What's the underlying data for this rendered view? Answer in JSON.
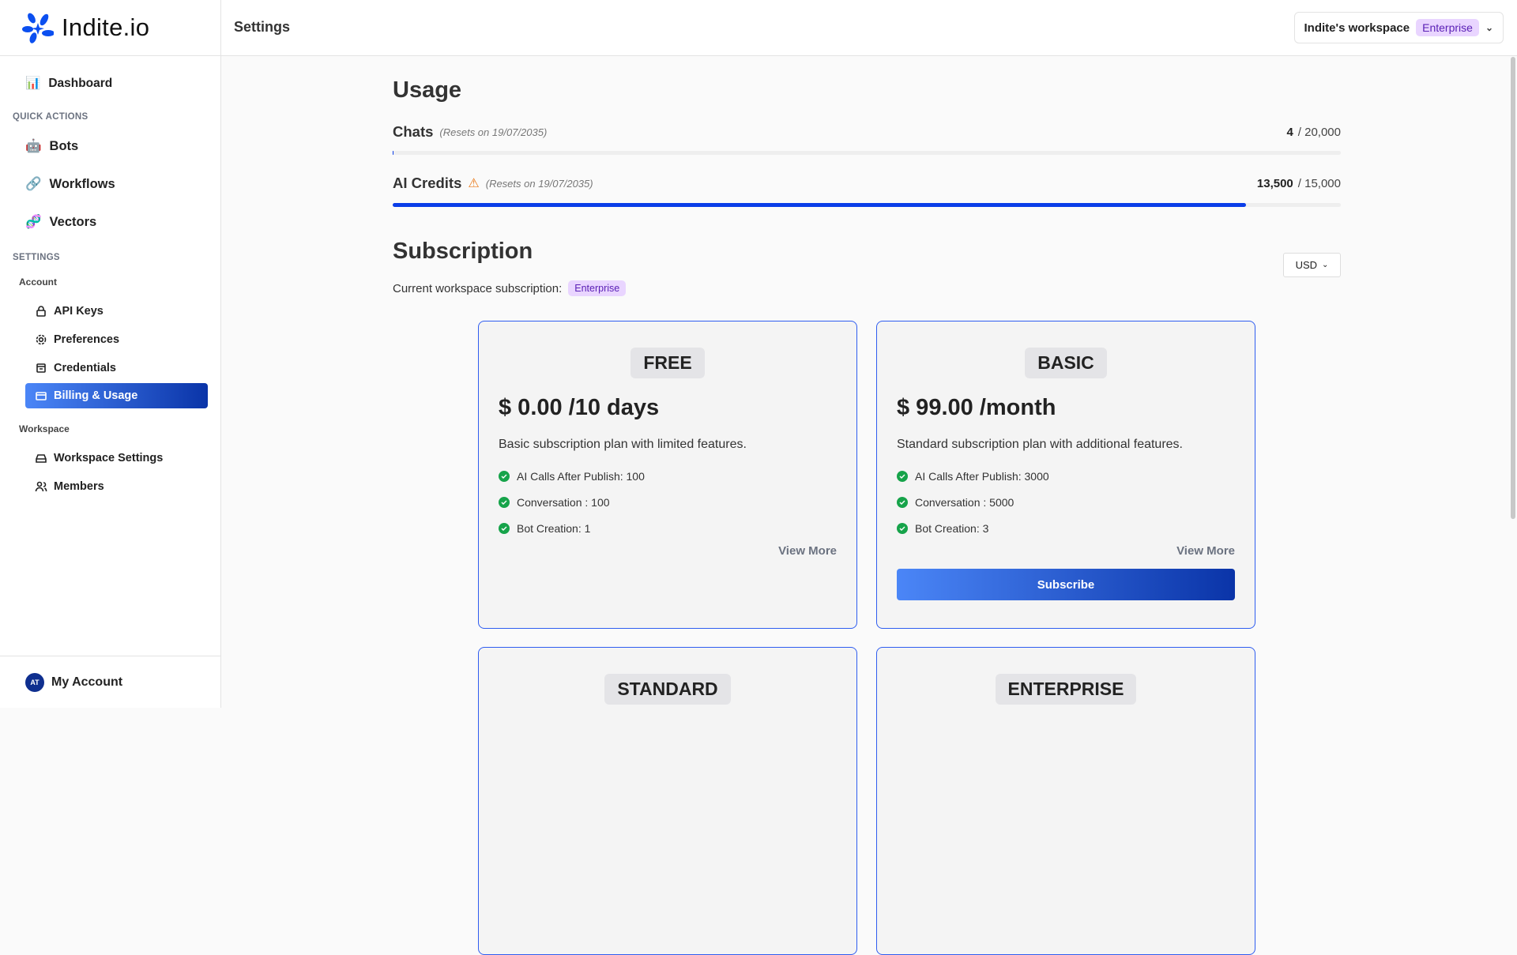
{
  "brand": {
    "name": "Indite.io",
    "accent": "#0a3de8"
  },
  "sidebar": {
    "dashboard": "Dashboard",
    "quick_actions_heading": "QUICK ACTIONS",
    "quick_actions": [
      {
        "label": "Bots",
        "icon": "🤖"
      },
      {
        "label": "Workflows",
        "icon": "🔗"
      },
      {
        "label": "Vectors",
        "icon": "🧬"
      }
    ],
    "settings_heading": "SETTINGS",
    "account_heading": "Account",
    "account_items": [
      {
        "label": "API Keys",
        "icon": "lock-icon"
      },
      {
        "label": "Preferences",
        "icon": "gear-icon"
      },
      {
        "label": "Credentials",
        "icon": "archive-icon"
      },
      {
        "label": "Billing & Usage",
        "icon": "credit-card-icon",
        "active": true
      }
    ],
    "workspace_heading": "Workspace",
    "workspace_items": [
      {
        "label": "Workspace Settings",
        "icon": "drive-icon"
      },
      {
        "label": "Members",
        "icon": "users-icon"
      }
    ],
    "account": {
      "initials": "AT",
      "label": "My Account"
    }
  },
  "header": {
    "title": "Settings",
    "workspace": "Indite's workspace",
    "plan_badge": "Enterprise"
  },
  "usage": {
    "title": "Usage",
    "chats": {
      "label": "Chats",
      "reset": "(Resets on 19/07/2035)",
      "used": "4",
      "total": "/ 20,000",
      "fraction": 0.0002
    },
    "credits": {
      "label": "AI Credits",
      "reset": "(Resets on 19/07/2035)",
      "used": "13,500",
      "total": "/ 15,000",
      "fraction": 0.9
    }
  },
  "subscription": {
    "title": "Subscription",
    "currency": "USD",
    "current_label": "Current workspace subscription:",
    "current_plan": "Enterprise",
    "plans": [
      {
        "name": "FREE",
        "price": "$ 0.00 /10 days",
        "description": "Basic subscription plan with limited features.",
        "features": [
          "AI Calls After Publish: 100",
          "Conversation : 100",
          "Bot Creation: 1"
        ],
        "view_more": "View More"
      },
      {
        "name": "BASIC",
        "price": "$ 99.00 /month",
        "description": "Standard subscription plan with additional features.",
        "features": [
          "AI Calls After Publish: 3000",
          "Conversation : 5000",
          "Bot Creation: 3"
        ],
        "view_more": "View More",
        "subscribe": "Subscribe"
      },
      {
        "name": "STANDARD"
      },
      {
        "name": "ENTERPRISE"
      }
    ]
  }
}
